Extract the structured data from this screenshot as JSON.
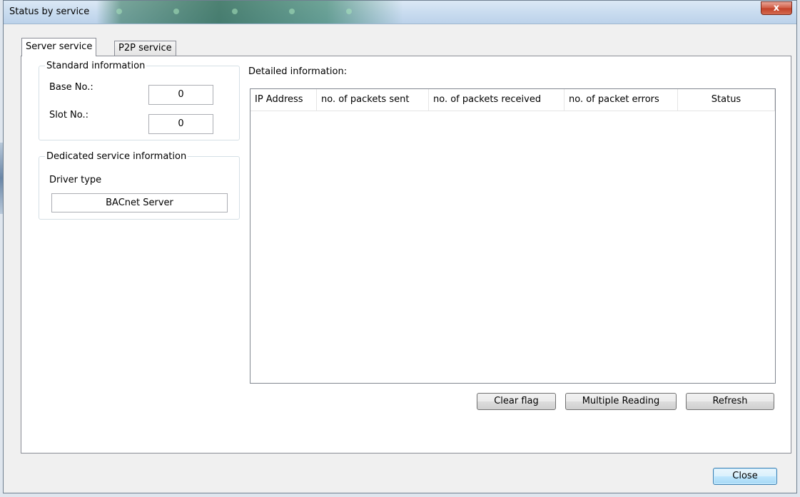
{
  "window": {
    "title": "Status by service",
    "close_glyph": "x"
  },
  "tabs": [
    {
      "label": "Server service",
      "active": true
    },
    {
      "label": "P2P service",
      "active": false
    }
  ],
  "standard_info": {
    "legend": "Standard information",
    "base_label": "Base No.:",
    "base_value": "0",
    "slot_label": "Slot No.:",
    "slot_value": "0"
  },
  "dedicated_info": {
    "legend": "Dedicated service information",
    "driver_label": "Driver type",
    "driver_value": "BACnet Server"
  },
  "detail": {
    "label": "Detailed information:",
    "columns": [
      "IP Address",
      "no. of packets sent",
      "no. of packets received",
      "no. of packet errors",
      "Status"
    ],
    "rows": []
  },
  "buttons": {
    "clear_flag": "Clear flag",
    "multiple_reading": "Multiple Reading",
    "refresh": "Refresh",
    "close": "Close"
  }
}
